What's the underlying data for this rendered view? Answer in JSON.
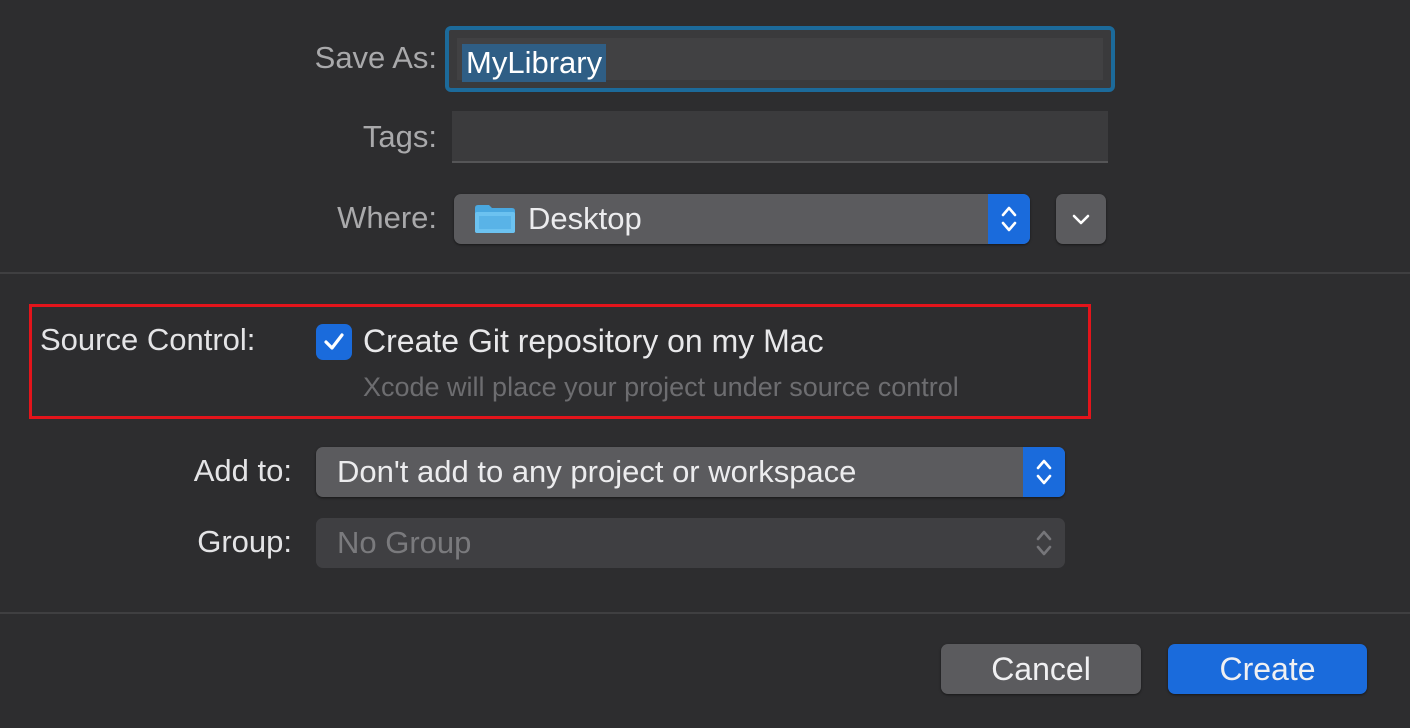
{
  "save_as": {
    "label": "Save As:",
    "value": "MyLibrary"
  },
  "tags": {
    "label": "Tags:",
    "value": ""
  },
  "where": {
    "label": "Where:",
    "value": "Desktop",
    "icon": "folder-icon"
  },
  "source_control": {
    "label": "Source Control:",
    "checkbox_label": "Create Git repository on my Mac",
    "checked": true,
    "hint": "Xcode will place your project under source control",
    "highlight_color": "#e3141b"
  },
  "add_to": {
    "label": "Add to:",
    "value": "Don't add to any project or workspace"
  },
  "group": {
    "label": "Group:",
    "value": "No Group",
    "disabled": true
  },
  "buttons": {
    "cancel": "Cancel",
    "create": "Create"
  },
  "colors": {
    "accent": "#1a6bdc",
    "focus_ring": "#1c6a9a",
    "background": "#2d2d2f"
  }
}
